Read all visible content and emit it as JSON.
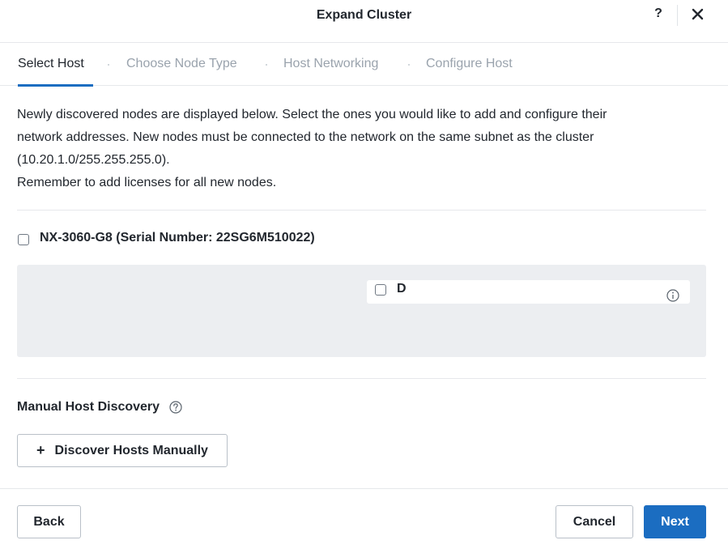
{
  "header": {
    "title": "Expand Cluster",
    "help_label": "?"
  },
  "tabs": [
    {
      "label": "Select Host",
      "active": true
    },
    {
      "label": "Choose Node Type",
      "active": false
    },
    {
      "label": "Host Networking",
      "active": false
    },
    {
      "label": "Configure Host",
      "active": false
    }
  ],
  "description": {
    "line1": "Newly discovered nodes are displayed below. Select the ones you would like to add and configure their",
    "line2": "network addresses. New nodes must be connected to the network on the same subnet as the cluster",
    "line3": "(10.20.1.0/255.255.255.0).",
    "line4": "Remember to add licenses for all new nodes."
  },
  "node": {
    "label": "NX-3060-G8 (Serial Number: 22SG6M510022)",
    "checked": false,
    "card_label": "D",
    "card_checked": false
  },
  "manual": {
    "label": "Manual Host Discovery",
    "button_label": "Discover Hosts Manually",
    "button_icon": "+"
  },
  "footer": {
    "back_label": "Back",
    "cancel_label": "Cancel",
    "next_label": "Next"
  },
  "colors": {
    "primary": "#1b6dc1",
    "text": "#22272e",
    "muted": "#9aa3ad",
    "panel": "#eceef1"
  }
}
